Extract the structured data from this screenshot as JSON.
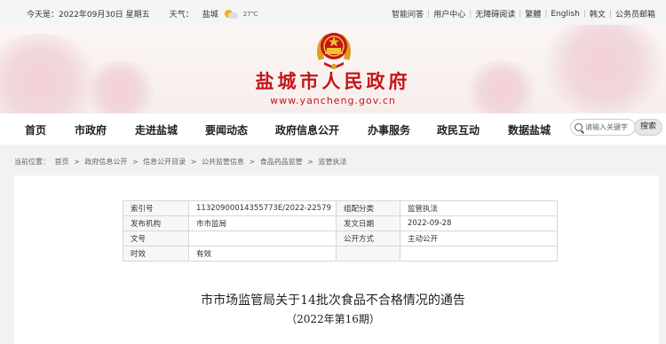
{
  "topbar": {
    "date": "今天是：2022年09月30日 星期五",
    "weather_label": "天气：",
    "city": "盐城",
    "temperature": "27℃",
    "links": [
      "智能问答",
      "用户中心",
      "无障碍阅读",
      "繁體",
      "English",
      "韩文",
      "公务员邮箱"
    ]
  },
  "header": {
    "title": "盐城市人民政府",
    "url": "www.yancheng.gov.cn",
    "title_color": "#c4161c"
  },
  "nav": {
    "items": [
      "首页",
      "市政府",
      "走进盐城",
      "要闻动态",
      "政府信息公开",
      "办事服务",
      "政民互动",
      "数据盐城"
    ],
    "search_placeholder": "请输入关键字",
    "search_button": "搜索"
  },
  "breadcrumb": {
    "label": "当前位置：",
    "items": [
      "首页",
      "政府信息公开",
      "信息公开目录",
      "公共监管信息",
      "食品药品监管",
      "监管执法"
    ],
    "separator": ">"
  },
  "meta": {
    "rows": [
      {
        "k1": "索引号",
        "v1": "11320900014355773E/2022-22579",
        "k2": "组配分类",
        "v2": "监管执法"
      },
      {
        "k1": "发布机构",
        "v1": "市市监局",
        "k2": "发文日期",
        "v2": "2022-09-28"
      },
      {
        "k1": "文号",
        "v1": "",
        "k2": "公开方式",
        "v2": "主动公开"
      },
      {
        "k1": "时效",
        "v1": "有效",
        "k2": "",
        "v2": ""
      }
    ]
  },
  "article": {
    "title": "市市场监管局关于14批次食品不合格情况的通告",
    "subtitle": "（2022年第16期）"
  }
}
